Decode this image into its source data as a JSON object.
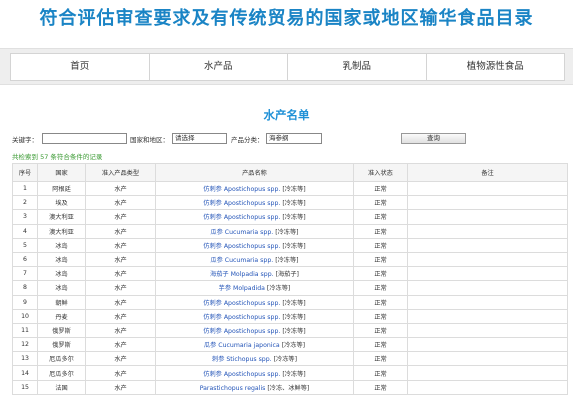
{
  "header": {
    "title": "符合评估审查要求及有传统贸易的国家或地区输华食品目录"
  },
  "nav": {
    "items": [
      {
        "label": "首页"
      },
      {
        "label": "水产品"
      },
      {
        "label": "乳制品"
      },
      {
        "label": "植物源性食品"
      }
    ]
  },
  "list_title": "水产名单",
  "search": {
    "keyword_label": "关键字：",
    "keyword_value": "",
    "region_label": "国家和地区：",
    "region_value": "请选择",
    "category_label": "产品分类：",
    "category_value": "海参纲",
    "query_button": "查询"
  },
  "result_count": "共检索到 57 条符合条件的记录",
  "table": {
    "columns": [
      "序号",
      "国家",
      "准入产品类型",
      "产品名称",
      "准入状态",
      "备注"
    ],
    "rows": [
      {
        "no": "1",
        "country": "阿根廷",
        "type": "水产",
        "name": "仿刺参 Apostichopus spp.",
        "tag": "[冷冻等]",
        "status": "正常",
        "note": ""
      },
      {
        "no": "2",
        "country": "埃及",
        "type": "水产",
        "name": "仿刺参 Apostichopus spp.",
        "tag": "[冷冻等]",
        "status": "正常",
        "note": ""
      },
      {
        "no": "3",
        "country": "澳大利亚",
        "type": "水产",
        "name": "仿刺参 Apostichopus spp.",
        "tag": "[冷冻等]",
        "status": "正常",
        "note": ""
      },
      {
        "no": "4",
        "country": "澳大利亚",
        "type": "水产",
        "name": "瓜参 Cucumaria spp.",
        "tag": "[冷冻等]",
        "status": "正常",
        "note": ""
      },
      {
        "no": "5",
        "country": "冰岛",
        "type": "水产",
        "name": "仿刺参 Apostichopus spp.",
        "tag": "[冷冻等]",
        "status": "正常",
        "note": ""
      },
      {
        "no": "6",
        "country": "冰岛",
        "type": "水产",
        "name": "瓜参 Cucumaria spp.",
        "tag": "[冷冻等]",
        "status": "正常",
        "note": ""
      },
      {
        "no": "7",
        "country": "冰岛",
        "type": "水产",
        "name": "海茄子 Molpadia spp.",
        "tag": "[海茄子]",
        "status": "正常",
        "note": ""
      },
      {
        "no": "8",
        "country": "冰岛",
        "type": "水产",
        "name": "芋参 Molpadida",
        "tag": "[冷冻等]",
        "status": "正常",
        "note": ""
      },
      {
        "no": "9",
        "country": "朝鲜",
        "type": "水产",
        "name": "仿刺参 Apostichopus spp.",
        "tag": "[冷冻等]",
        "status": "正常",
        "note": ""
      },
      {
        "no": "10",
        "country": "丹麦",
        "type": "水产",
        "name": "仿刺参 Apostichopus spp.",
        "tag": "[冷冻等]",
        "status": "正常",
        "note": ""
      },
      {
        "no": "11",
        "country": "俄罗斯",
        "type": "水产",
        "name": "仿刺参 Apostichopus spp.",
        "tag": "[冷冻等]",
        "status": "正常",
        "note": ""
      },
      {
        "no": "12",
        "country": "俄罗斯",
        "type": "水产",
        "name": "瓜参 Cucumaria japonica",
        "tag": "[冷冻等]",
        "status": "正常",
        "note": ""
      },
      {
        "no": "13",
        "country": "厄瓜多尔",
        "type": "水产",
        "name": "刺参 Stichopus spp.",
        "tag": "[冷冻等]",
        "status": "正常",
        "note": ""
      },
      {
        "no": "14",
        "country": "厄瓜多尔",
        "type": "水产",
        "name": "仿刺参 Apostichopus spp.",
        "tag": "[冷冻等]",
        "status": "正常",
        "note": ""
      },
      {
        "no": "15",
        "country": "法国",
        "type": "水产",
        "name": "Parastichopus regalis",
        "tag": "[冷冻、冰鲜等]",
        "status": "正常",
        "note": ""
      }
    ]
  },
  "colors": {
    "title": "#1a84c5",
    "list_title": "#1e90d6",
    "link": "#2455b8",
    "result_count": "#3a9a32"
  }
}
